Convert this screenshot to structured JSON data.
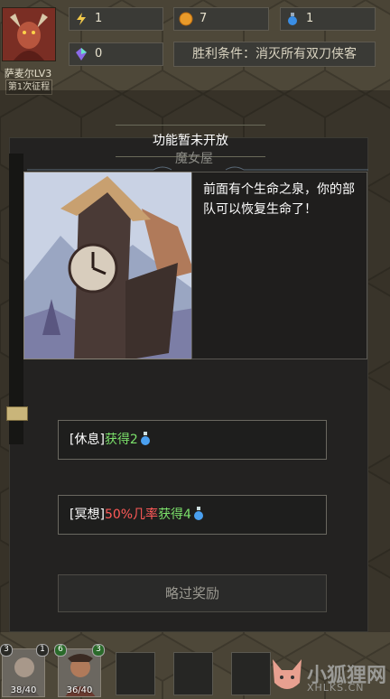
{
  "hero": {
    "name": "萨麦尔LV3",
    "expedition": "第1次征程"
  },
  "resources": {
    "energy": "1",
    "gold": "7",
    "potion": "1",
    "gem": "0"
  },
  "victory_condition": "胜利条件：消灭所有双刀侠客",
  "notice": "功能暂未开放",
  "event": {
    "title": "魔女屋",
    "description": "前面有个生命之泉，你的部队可以恢复生命了！"
  },
  "options": [
    {
      "prefix": "[休息]",
      "reward": "获得2"
    },
    {
      "prefix": "[冥想]",
      "chance": "50%几率",
      "reward": "获得4"
    }
  ],
  "skip_label": "略过奖励",
  "party": [
    {
      "level": "3",
      "hp": "38/40"
    },
    {
      "level": "6",
      "hp": "36/40"
    }
  ],
  "unit_markers": [
    "1",
    "3"
  ],
  "watermark": {
    "cn": "小狐狸网",
    "en": "XHLKS.CN"
  },
  "colors": {
    "green": "#7be06a",
    "red": "#ff5a58"
  }
}
